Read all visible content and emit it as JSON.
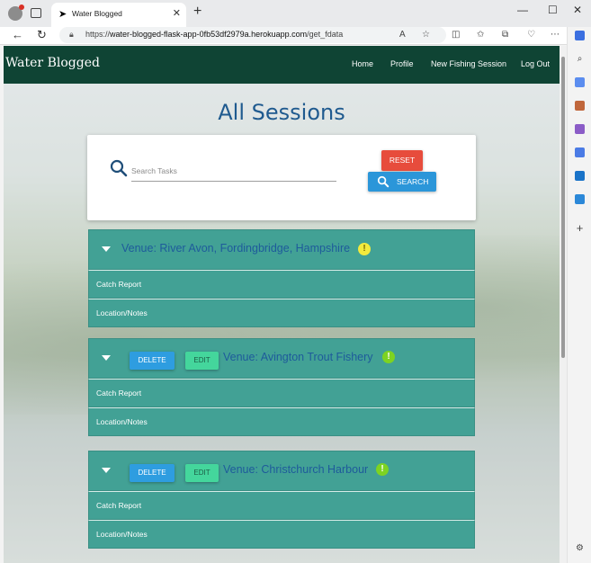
{
  "browser": {
    "tab_title": "Water Blogged",
    "url_prefix": "https://",
    "url_host": "water-blogged-flask-app-0fb53df2979a.herokuapp.com",
    "url_path": "/get_fdata"
  },
  "nav": {
    "brand": "Water Blogged",
    "links": [
      "Home",
      "Profile",
      "New Fishing Session",
      "Log Out"
    ]
  },
  "page": {
    "title": "All Sessions"
  },
  "search": {
    "placeholder": "Search Tasks",
    "reset_label": "RESET",
    "search_label": "SEARCH"
  },
  "sessions": [
    {
      "venue": "Venue: River Avon, Fordingbridge, Hampshire",
      "has_actions": false,
      "warn_color": "#f2ea3d",
      "rows": [
        "Catch Report",
        "Location/Notes"
      ]
    },
    {
      "venue": "Venue: Avington Trout Fishery",
      "has_actions": true,
      "delete_label": "DELETE",
      "edit_label": "EDIT",
      "warn_color": "#7ed321",
      "rows": [
        "Catch Report",
        "Location/Notes"
      ]
    },
    {
      "venue": "Venue: Christchurch Harbour",
      "has_actions": true,
      "delete_label": "DELETE",
      "edit_label": "EDIT",
      "warn_color": "#7ed321",
      "rows": [
        "Catch Report",
        "Location/Notes"
      ]
    }
  ],
  "colors": {
    "nav_bg": "#0f4434",
    "session_bg": "#42a195",
    "title": "#1f5a8f",
    "reset": "#e74c3c",
    "search": "#2b96d9"
  }
}
